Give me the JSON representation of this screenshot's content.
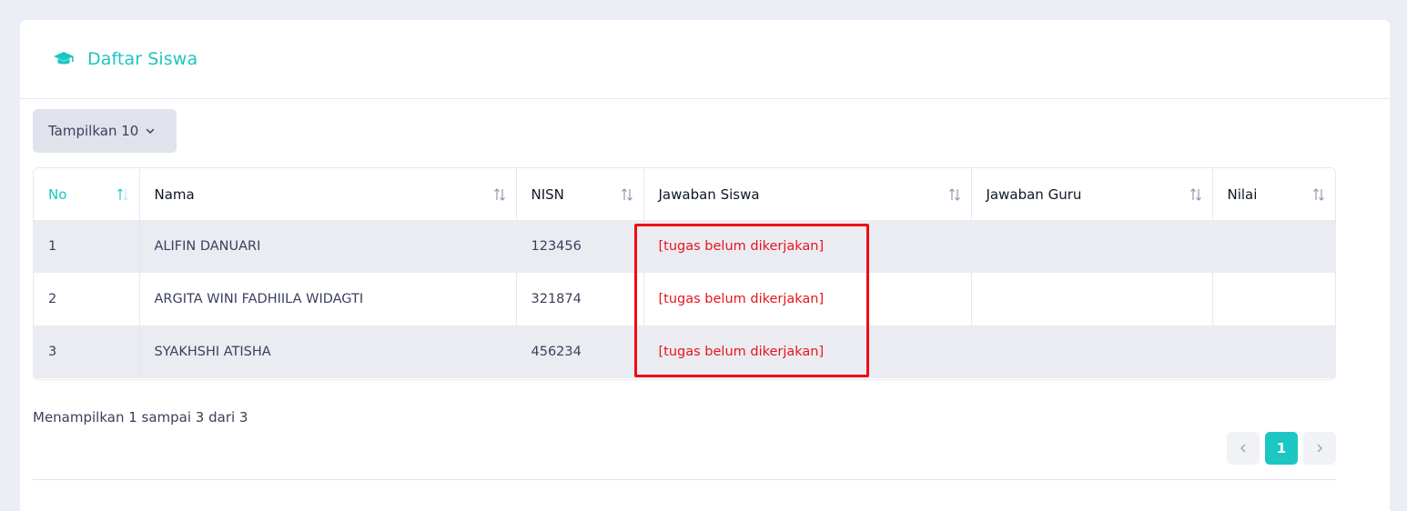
{
  "header": {
    "title": "Daftar Siswa",
    "icon": "graduation-cap-icon"
  },
  "length_menu": {
    "label": "Tampilkan 10"
  },
  "table": {
    "columns": [
      "No",
      "Nama",
      "NISN",
      "Jawaban Siswa",
      "Jawaban Guru",
      "Nilai"
    ],
    "rows": [
      {
        "no": "1",
        "nama": "ALIFIN DANUARI",
        "nisn": "123456",
        "jawaban_siswa": "[tugas belum dikerjakan]",
        "jawaban_guru": "",
        "nilai": ""
      },
      {
        "no": "2",
        "nama": "ARGITA WINI FADHIILA WIDAGTI",
        "nisn": "321874",
        "jawaban_siswa": "[tugas belum dikerjakan]",
        "jawaban_guru": "",
        "nilai": ""
      },
      {
        "no": "3",
        "nama": "SYAKHSHI ATISHA",
        "nisn": "456234",
        "jawaban_siswa": "[tugas belum dikerjakan]",
        "jawaban_guru": "",
        "nilai": ""
      }
    ]
  },
  "info": "Menampilkan 1 sampai 3 dari 3",
  "pagination": {
    "current": "1"
  },
  "colors": {
    "accent": "#1cc6c2",
    "status_red": "#e7151b",
    "highlight": "#ef0c14"
  }
}
